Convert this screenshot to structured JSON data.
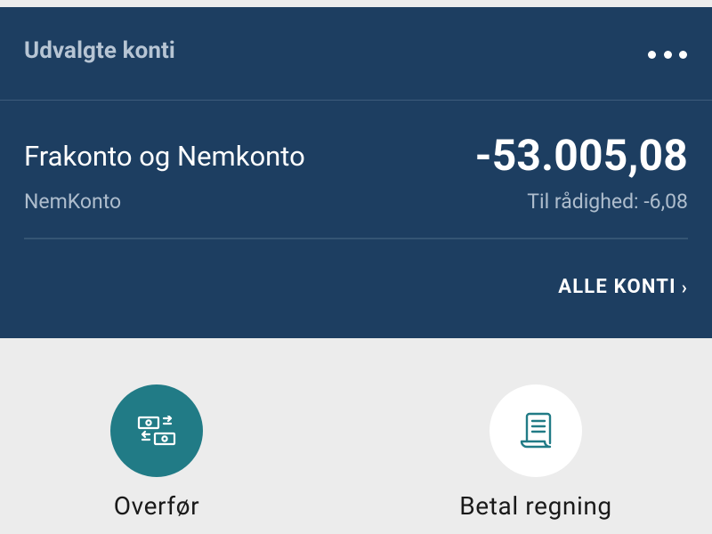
{
  "card": {
    "title": "Udvalgte konti",
    "more_icon": "more-horizontal-icon",
    "account": {
      "name": "Frakonto og Nemkonto",
      "type": "NemKonto",
      "balance": "-53.005,08",
      "available": "Til rådighed: -6,08"
    },
    "all_accounts_label": "ALLE KONTI",
    "all_accounts_chevron": "›"
  },
  "actions": [
    {
      "label": "Overfør",
      "icon": "money-transfer-icon",
      "color": "#217b86"
    },
    {
      "label": "Betal regning",
      "icon": "bill-receipt-icon",
      "color": "#ffffff"
    }
  ],
  "colors": {
    "card_bg": "#1d3e61",
    "page_bg": "#ececec",
    "accent": "#217b86"
  }
}
